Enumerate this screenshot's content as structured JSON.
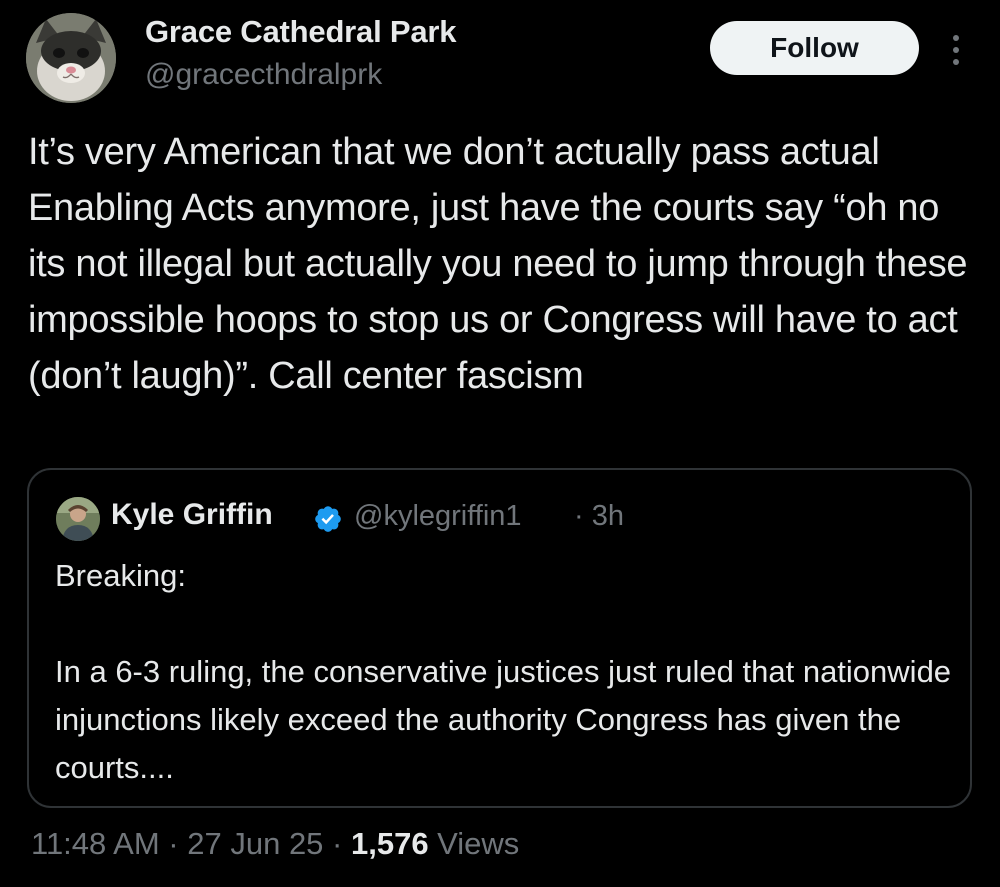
{
  "tweet": {
    "author": {
      "display_name": "Grace Cathedral Park",
      "handle": "@gracecthdralprk",
      "avatar_icon": "cat-avatar-icon"
    },
    "follow_label": "Follow",
    "more_icon": "vertical-ellipsis-icon",
    "text": "It’s very American that we don’t actually pass actual Enabling Acts anymore, just have the courts say “oh no its not illegal but actually you need to jump through these impossible hoops to stop us or Congress will have to act (don’t laugh)”. Call center fascism",
    "quote": {
      "display_name": "Kyle Griffin",
      "verified_icon": "verified-badge-icon",
      "handle": "@kylegriffin1",
      "time": "· 3h",
      "text": "Breaking:\n\nIn a 6-3 ruling, the conservative justices just ruled that nationwide injunctions likely exceed the authority Congress has given the courts...."
    },
    "meta": {
      "time": "11:48 AM",
      "sep1": " · ",
      "date": "27 Jun 25",
      "sep2": " · ",
      "views_count": "1,576",
      "views_label": " Views"
    }
  },
  "colors": {
    "background": "#000000",
    "primary_text": "#e7e9ea",
    "secondary_text": "#71767b",
    "border": "#2f3336",
    "follow_button_bg": "#eff3f4",
    "verified_blue": "#1d9bf0"
  }
}
